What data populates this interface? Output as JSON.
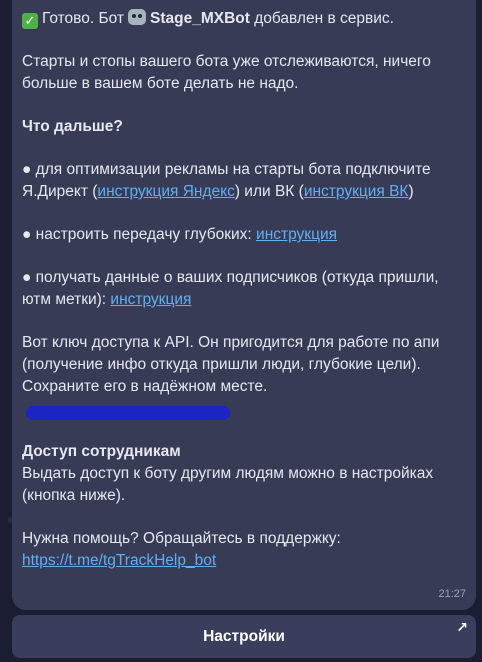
{
  "message": {
    "line1_prefix": "Готово. Бот",
    "bot_name": "Stage_MXBot",
    "line1_suffix": "добавлен в сервис.",
    "para1": "Старты и стопы вашего бота уже отслеживаются, ничего больше в вашем боте делать не надо.",
    "next_heading": "Что дальше?",
    "b1_prefix": "● для оптимизации рекламы на старты бота подключите Я.Директ (",
    "b1_link1": "инструкция Яндекс",
    "b1_mid": ") или ВК (",
    "b1_link2": "инструкция ВК",
    "b1_suffix": ")",
    "b2_prefix": "● настроить передачу глубоких: ",
    "b2_link": "инструкция",
    "b3_prefix": "● получать данные о ваших подписчиков (откуда пришли, ютм метки): ",
    "b3_link": "инструкция",
    "api_para": "Вот ключ доступа к API. Он пригодится для работе по апи (получение инфо откуда пришли люди, глубокие цели). Сохраните его в надёжном месте.",
    "staff_heading": "Доступ сотрудникам",
    "staff_text": "Выдать доступ к боту другим людям можно в настройках (кнопка ниже).",
    "help_text": "Нужна помощь? Обращайтесь в поддержку:",
    "help_link": "https://t.me/tgTrackHelp_bot",
    "time": "21:27"
  },
  "button": {
    "label": "Настройки"
  },
  "icons": {
    "check": "check-mark-icon",
    "robot": "robot-icon",
    "button_arrow": "arrow-up-right-icon"
  },
  "colors": {
    "bubble": "#383b56",
    "link": "#5fb0f2",
    "redaction": "#1c24c4",
    "check": "#52b04a"
  }
}
